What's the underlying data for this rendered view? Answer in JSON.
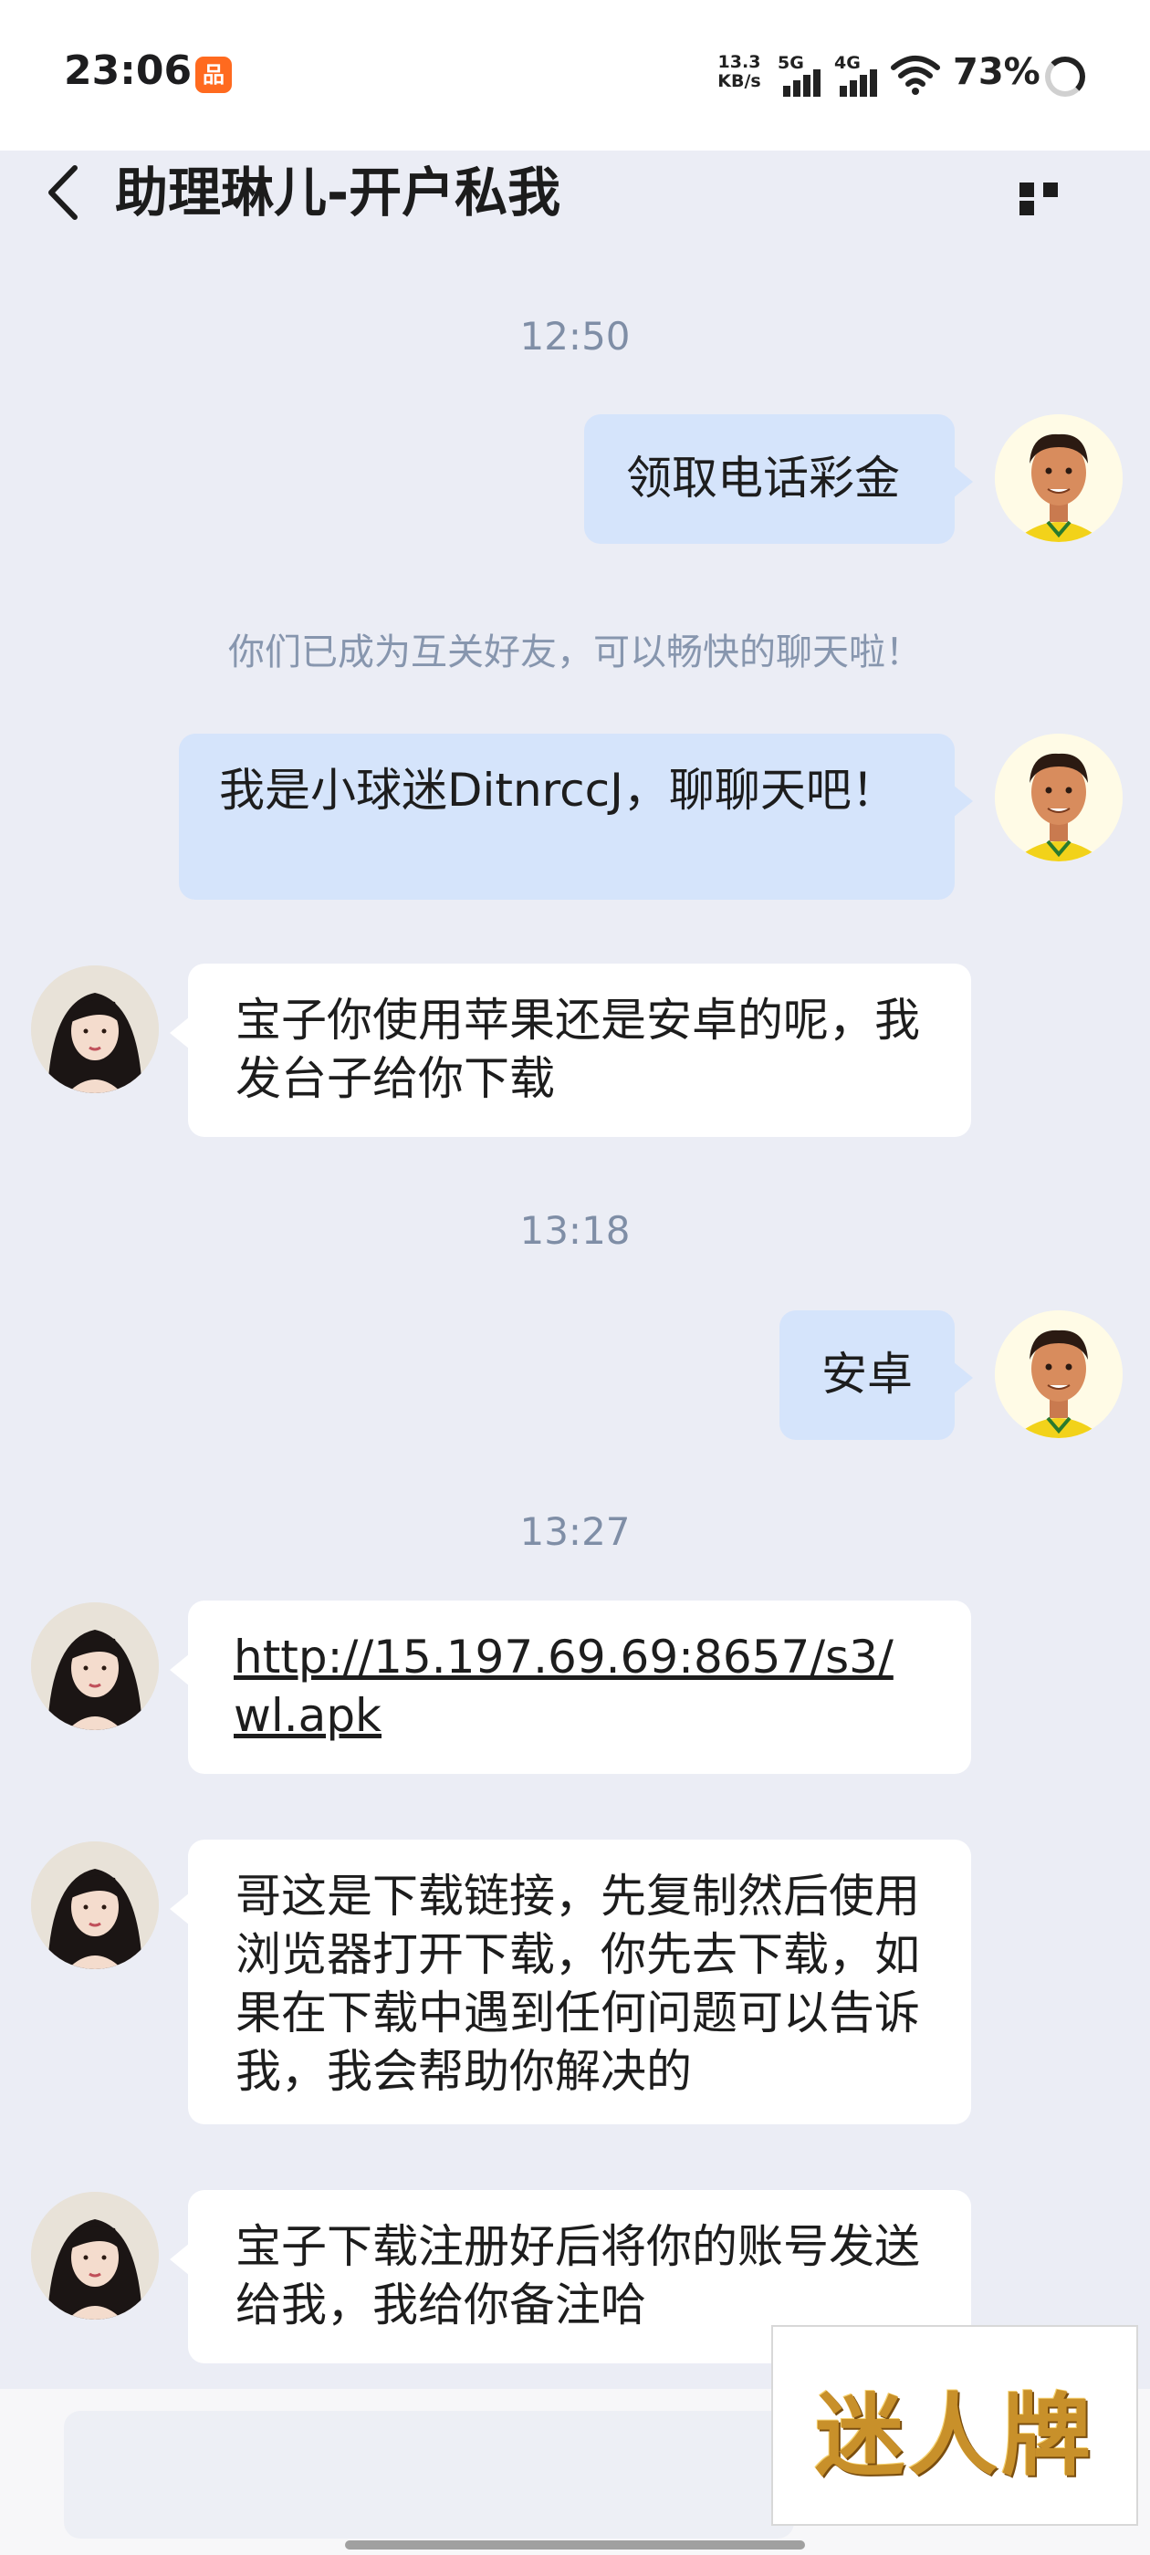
{
  "status_bar": {
    "time": "23:06",
    "app_badge": "品",
    "net_speed_value": "13.3",
    "net_speed_unit": "KB/s",
    "signal1": "5G",
    "signal2": "4G",
    "battery": "73%"
  },
  "header": {
    "title": "助理琳儿-开户私我",
    "back_icon": "chevron-left-icon",
    "more_icon": "more-dots-icon"
  },
  "messages": [
    {
      "type": "timestamp",
      "text": "12:50"
    },
    {
      "type": "sent",
      "text": "领取电话彩金"
    },
    {
      "type": "system",
      "text": "你们已成为互关好友，可以畅快的聊天啦！"
    },
    {
      "type": "sent",
      "text": "我是小球迷DitnrccJ，聊聊天吧！"
    },
    {
      "type": "received",
      "text": "宝子你使用苹果还是安卓的呢，我发台子给你下载"
    },
    {
      "type": "timestamp",
      "text": "13:18"
    },
    {
      "type": "sent",
      "text": "安卓"
    },
    {
      "type": "timestamp",
      "text": "13:27"
    },
    {
      "type": "received_link",
      "text": "http://15.197.69.69:8657/s3/wl.apk"
    },
    {
      "type": "received",
      "text": "哥这是下载链接，先复制然后使用浏览器打开下载，你先去下载，如果在下载中遇到任何问题可以告诉我，我会帮助你解决的"
    },
    {
      "type": "received",
      "text": "宝子下载注册好后将你的账号发送给我，我给你备注哈"
    }
  ],
  "watermark": {
    "text": "迷人牌"
  },
  "colors": {
    "chat_background": "#ebedf5",
    "sent_bubble": "#d5e4fb",
    "received_bubble": "#ffffff",
    "timestamp_text": "#7f8ea6"
  }
}
